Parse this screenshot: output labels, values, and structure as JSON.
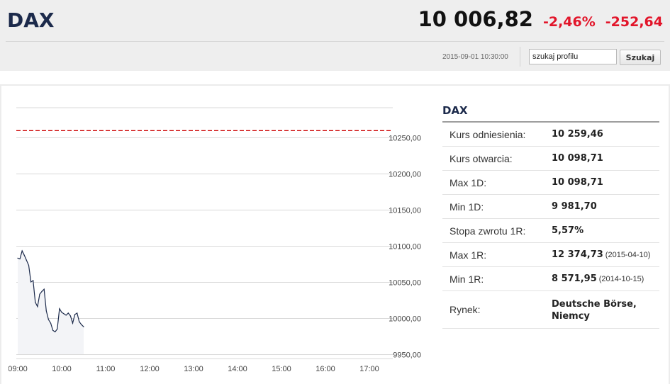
{
  "header": {
    "title": "DAX",
    "price": "10 006,82",
    "change_pct": "-2,46%",
    "change_abs": "-252,64",
    "timestamp": "2015-09-01 10:30:00"
  },
  "search": {
    "value": "szukaj profilu",
    "button_label": "Szukaj"
  },
  "info": {
    "title": "DAX",
    "rows": [
      {
        "label": "Kurs odniesienia:",
        "value": "10 259,46",
        "date": ""
      },
      {
        "label": "Kurs otwarcia:",
        "value": "10 098,71",
        "date": ""
      },
      {
        "label": "Max 1D:",
        "value": "10 098,71",
        "date": ""
      },
      {
        "label": "Min 1D:",
        "value": "9 981,70",
        "date": ""
      },
      {
        "label": "Stopa zwrotu 1R:",
        "value": "5,57%",
        "date": ""
      },
      {
        "label": "Max 1R:",
        "value": "12 374,73",
        "date": "(2015-04-10)"
      },
      {
        "label": "Min 1R:",
        "value": "8 571,95",
        "date": "(2014-10-15)"
      },
      {
        "label": "Rynek:",
        "value": "Deutsche Börse, Niemcy",
        "date": ""
      }
    ]
  },
  "colors": {
    "title_navy": "#1c2a4b",
    "negative_red": "#e2152a",
    "reference_line": "#cc0000",
    "series_line": "#1c2a4b",
    "area_fill": "#f3f4f7"
  },
  "chart_data": {
    "type": "area",
    "y_ticks": [
      "10250,00",
      "10200,00",
      "10150,00",
      "10100,00",
      "10050,00",
      "10000,00",
      "9950,00"
    ],
    "x_ticks": [
      "09:00",
      "10:00",
      "11:00",
      "12:00",
      "13:00",
      "14:00",
      "15:00",
      "16:00",
      "17:00"
    ],
    "ylim": [
      9950,
      10300
    ],
    "xlim": [
      "09:00",
      "17:30"
    ],
    "reference_value": 10259.46,
    "grid": true,
    "series": [
      {
        "x": [
          "09:00",
          "09:03",
          "09:06",
          "09:09",
          "09:12",
          "09:15",
          "09:18",
          "09:21",
          "09:24",
          "09:27",
          "09:30",
          "09:33",
          "09:36",
          "09:39",
          "09:42",
          "09:45",
          "09:48",
          "09:51",
          "09:54",
          "09:57",
          "10:00",
          "10:03",
          "10:06",
          "10:09",
          "10:12",
          "10:15",
          "10:18",
          "10:21",
          "10:24",
          "10:27",
          "10:30"
        ],
        "y": [
          10083,
          10082,
          10093,
          10087,
          10080,
          10073,
          10050,
          10052,
          10022,
          10016,
          10033,
          10037,
          10040,
          10010,
          9998,
          9993,
          9983,
          9981,
          9985,
          10013,
          10008,
          10006,
          10004,
          10007,
          10003,
          9993,
          10005,
          10007,
          9995,
          9991,
          9988
        ]
      }
    ]
  }
}
